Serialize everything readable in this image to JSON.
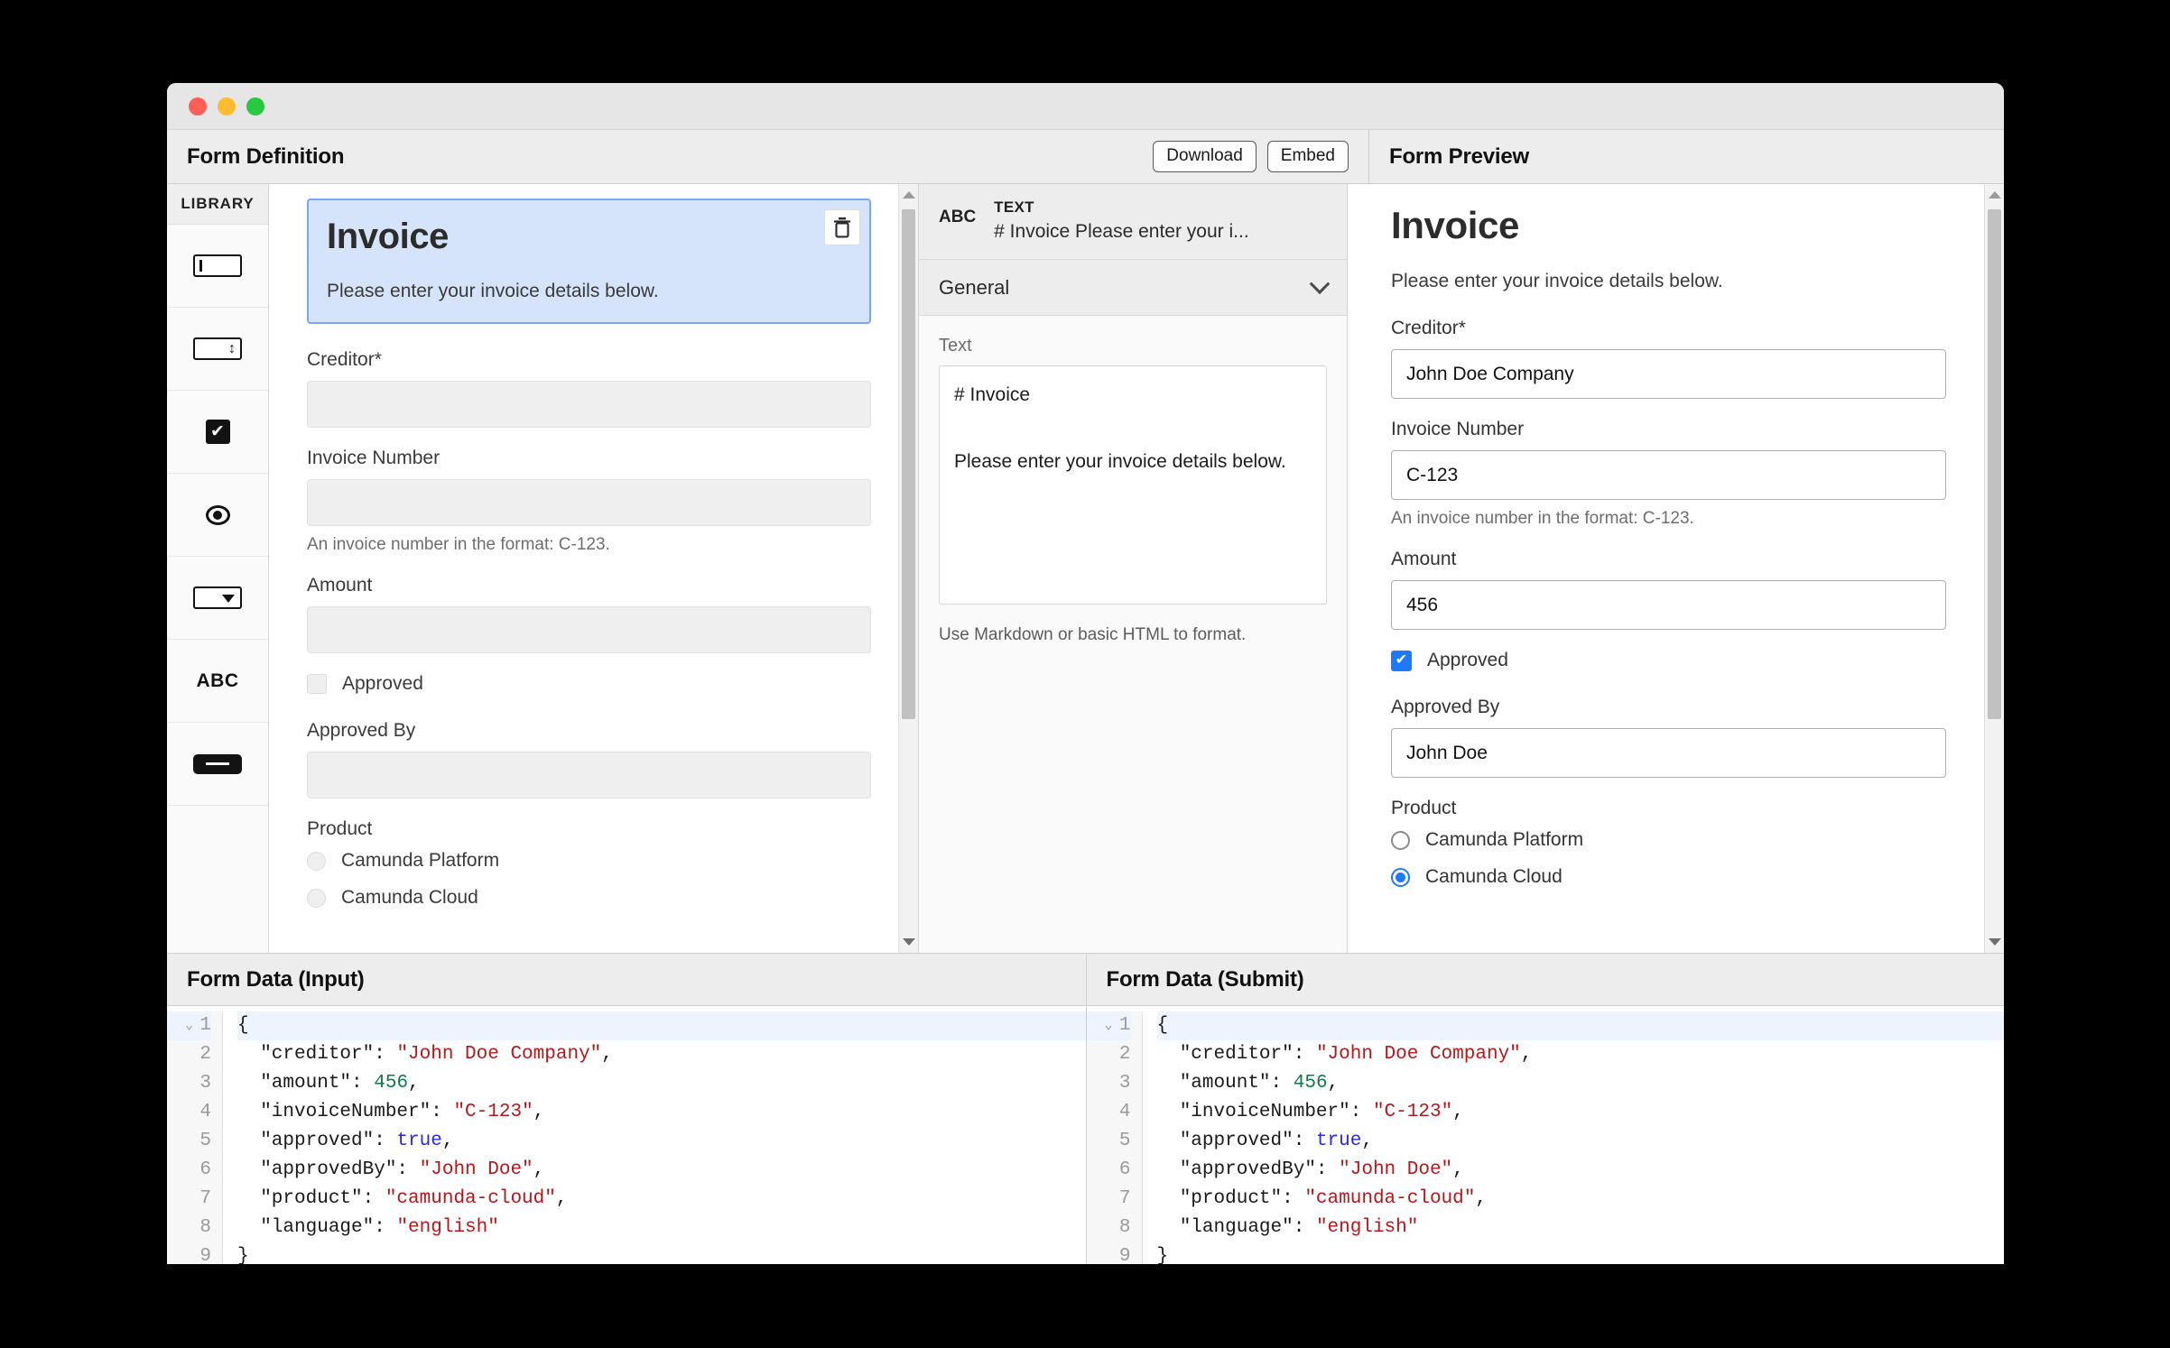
{
  "window": {
    "traffic_lights": [
      "close",
      "minimize",
      "maximize"
    ]
  },
  "header": {
    "definition_title": "Form Definition",
    "preview_title": "Form Preview",
    "download_label": "Download",
    "embed_label": "Embed"
  },
  "library": {
    "title": "LIBRARY",
    "items": [
      {
        "icon": "textfield-icon",
        "name": "Text Field"
      },
      {
        "icon": "number-icon",
        "name": "Number"
      },
      {
        "icon": "checkbox-icon",
        "name": "Checkbox"
      },
      {
        "icon": "radio-icon",
        "name": "Radio"
      },
      {
        "icon": "select-icon",
        "name": "Select"
      },
      {
        "icon": "abc-text-icon",
        "name": "ABC"
      },
      {
        "icon": "button-icon",
        "name": "Button"
      }
    ],
    "abc_glyph": "ABC",
    "check_glyph": "✔"
  },
  "editor": {
    "selected": {
      "heading": "Invoice",
      "paragraph": "Please enter your invoice details below.",
      "delete_icon": "trash-icon"
    },
    "fields": [
      {
        "label": "Creditor*",
        "value": "",
        "hint": ""
      },
      {
        "label": "Invoice Number",
        "value": "",
        "hint": "An invoice number in the format: C-123."
      },
      {
        "label": "Amount",
        "value": "",
        "hint": ""
      }
    ],
    "checkbox": {
      "label": "Approved",
      "checked": false
    },
    "approved_by": {
      "label": "Approved By",
      "value": ""
    },
    "product": {
      "label": "Product",
      "options": [
        {
          "label": "Camunda Platform",
          "selected": false
        },
        {
          "label": "Camunda Cloud",
          "selected": false
        }
      ]
    }
  },
  "properties": {
    "element_type": "TEXT",
    "element_name": "# Invoice Please enter your i...",
    "type_badge": "ABC",
    "group_label": "General",
    "text_label": "Text",
    "text_value": "# Invoice\n\nPlease enter your invoice details below.",
    "text_hint": "Use Markdown or basic HTML to format."
  },
  "preview": {
    "heading": "Invoice",
    "intro": "Please enter your invoice details below.",
    "fields": [
      {
        "label": "Creditor*",
        "value": "John Doe Company",
        "hint": ""
      },
      {
        "label": "Invoice Number",
        "value": "C-123",
        "hint": "An invoice number in the format: C-123."
      },
      {
        "label": "Amount",
        "value": "456",
        "hint": ""
      }
    ],
    "checkbox": {
      "label": "Approved",
      "checked": true,
      "glyph": "✔"
    },
    "approved_by": {
      "label": "Approved By",
      "value": "John Doe"
    },
    "product": {
      "label": "Product",
      "options": [
        {
          "label": "Camunda Platform",
          "selected": false
        },
        {
          "label": "Camunda Cloud",
          "selected": true
        }
      ]
    }
  },
  "form_data_input": {
    "title": "Form Data (Input)",
    "lines": [
      {
        "n": "1",
        "fold": "⌄",
        "tokens": [
          {
            "t": "punct",
            "v": "{"
          }
        ]
      },
      {
        "n": "2",
        "fold": "",
        "tokens": [
          {
            "t": "key",
            "v": "  \"creditor\": "
          },
          {
            "t": "str",
            "v": "\"John Doe Company\""
          },
          {
            "t": "punct",
            "v": ","
          }
        ]
      },
      {
        "n": "3",
        "fold": "",
        "tokens": [
          {
            "t": "key",
            "v": "  \"amount\": "
          },
          {
            "t": "num",
            "v": "456"
          },
          {
            "t": "punct",
            "v": ","
          }
        ]
      },
      {
        "n": "4",
        "fold": "",
        "tokens": [
          {
            "t": "key",
            "v": "  \"invoiceNumber\": "
          },
          {
            "t": "str",
            "v": "\"C-123\""
          },
          {
            "t": "punct",
            "v": ","
          }
        ]
      },
      {
        "n": "5",
        "fold": "",
        "tokens": [
          {
            "t": "key",
            "v": "  \"approved\": "
          },
          {
            "t": "bool",
            "v": "true"
          },
          {
            "t": "punct",
            "v": ","
          }
        ]
      },
      {
        "n": "6",
        "fold": "",
        "tokens": [
          {
            "t": "key",
            "v": "  \"approvedBy\": "
          },
          {
            "t": "str",
            "v": "\"John Doe\""
          },
          {
            "t": "punct",
            "v": ","
          }
        ]
      },
      {
        "n": "7",
        "fold": "",
        "tokens": [
          {
            "t": "key",
            "v": "  \"product\": "
          },
          {
            "t": "str",
            "v": "\"camunda-cloud\""
          },
          {
            "t": "punct",
            "v": ","
          }
        ]
      },
      {
        "n": "8",
        "fold": "",
        "tokens": [
          {
            "t": "key",
            "v": "  \"language\": "
          },
          {
            "t": "str",
            "v": "\"english\""
          }
        ]
      },
      {
        "n": "9",
        "fold": "",
        "tokens": [
          {
            "t": "punct",
            "v": "}"
          }
        ]
      }
    ]
  },
  "form_data_submit": {
    "title": "Form Data (Submit)",
    "lines": [
      {
        "n": "1",
        "fold": "⌄",
        "tokens": [
          {
            "t": "punct",
            "v": "{"
          }
        ]
      },
      {
        "n": "2",
        "fold": "",
        "tokens": [
          {
            "t": "key",
            "v": "  \"creditor\": "
          },
          {
            "t": "str",
            "v": "\"John Doe Company\""
          },
          {
            "t": "punct",
            "v": ","
          }
        ]
      },
      {
        "n": "3",
        "fold": "",
        "tokens": [
          {
            "t": "key",
            "v": "  \"amount\": "
          },
          {
            "t": "num",
            "v": "456"
          },
          {
            "t": "punct",
            "v": ","
          }
        ]
      },
      {
        "n": "4",
        "fold": "",
        "tokens": [
          {
            "t": "key",
            "v": "  \"invoiceNumber\": "
          },
          {
            "t": "str",
            "v": "\"C-123\""
          },
          {
            "t": "punct",
            "v": ","
          }
        ]
      },
      {
        "n": "5",
        "fold": "",
        "tokens": [
          {
            "t": "key",
            "v": "  \"approved\": "
          },
          {
            "t": "bool",
            "v": "true"
          },
          {
            "t": "punct",
            "v": ","
          }
        ]
      },
      {
        "n": "6",
        "fold": "",
        "tokens": [
          {
            "t": "key",
            "v": "  \"approvedBy\": "
          },
          {
            "t": "str",
            "v": "\"John Doe\""
          },
          {
            "t": "punct",
            "v": ","
          }
        ]
      },
      {
        "n": "7",
        "fold": "",
        "tokens": [
          {
            "t": "key",
            "v": "  \"product\": "
          },
          {
            "t": "str",
            "v": "\"camunda-cloud\""
          },
          {
            "t": "punct",
            "v": ","
          }
        ]
      },
      {
        "n": "8",
        "fold": "",
        "tokens": [
          {
            "t": "key",
            "v": "  \"language\": "
          },
          {
            "t": "str",
            "v": "\"english\""
          }
        ]
      },
      {
        "n": "9",
        "fold": "",
        "tokens": [
          {
            "t": "punct",
            "v": "}"
          }
        ]
      }
    ]
  },
  "colors": {
    "selection_fill": "#d5e4fb",
    "selection_border": "#7aa7f0",
    "accent_blue": "#1d7afc",
    "chrome": "#ededed"
  }
}
